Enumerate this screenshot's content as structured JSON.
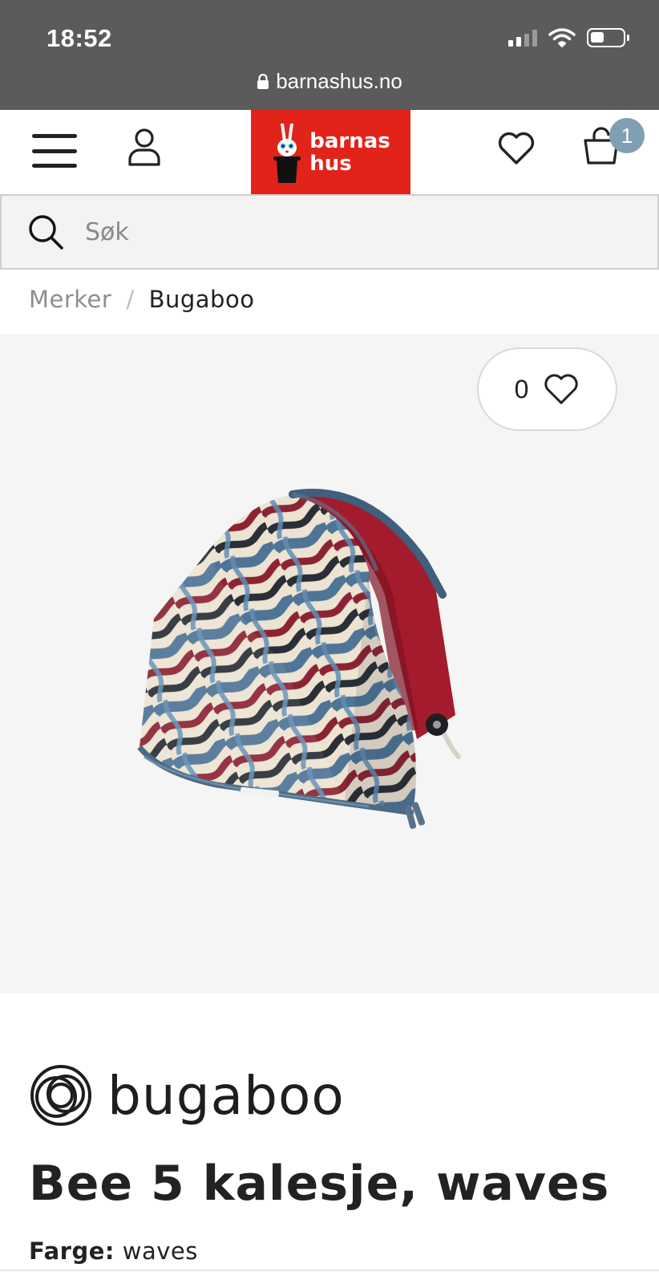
{
  "status_bar": {
    "time": "18:52",
    "icons": [
      "signal-icon",
      "wifi-icon",
      "battery-icon"
    ],
    "url": "barnashus.no"
  },
  "header": {
    "menu_icon": "hamburger-menu-icon",
    "account_icon": "user-icon",
    "logo_line1": "barnas",
    "logo_line2": "hus",
    "logo_color": "#e2231a",
    "wishlist_icon": "heart-icon",
    "cart_icon": "shopping-bag-icon",
    "cart_count": "1",
    "badge_color": "#7f9fb3"
  },
  "search": {
    "placeholder": "Søk"
  },
  "breadcrumb": {
    "items": [
      "Merker",
      "Bugaboo"
    ],
    "separator": "/"
  },
  "product": {
    "favorite_count": "0",
    "image_alt": "Bugaboo Bee 5 sun canopy with waves pattern",
    "brand": "bugaboo",
    "title": "Bee 5 kalesje, waves",
    "color_label": "Farge:",
    "color_value": "waves"
  }
}
